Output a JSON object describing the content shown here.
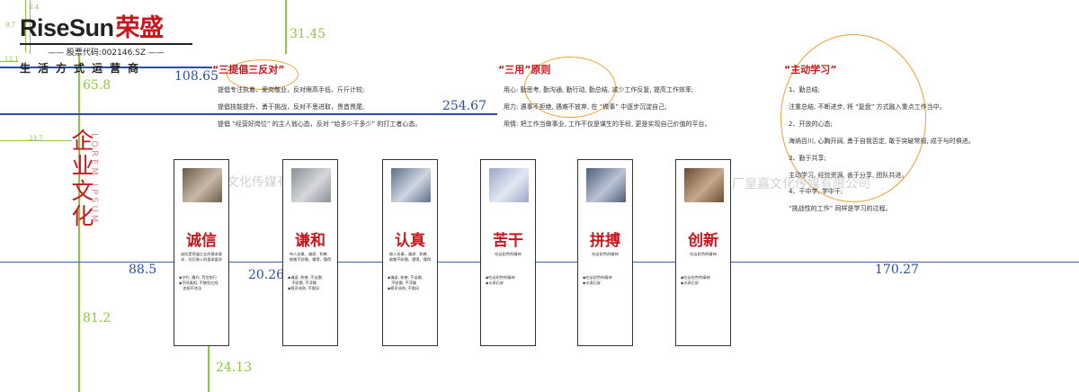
{
  "logo": {
    "brand_latin": "RiseSun",
    "brand_cn": "荣盛",
    "stock": "—— 股票代码:002146.SZ ——",
    "slogan": "生活方式运营商"
  },
  "guides": {
    "green": [
      "8.4",
      "9.7",
      "31.45",
      "12.1",
      "65.8",
      "33.7",
      "81.2",
      "24.13"
    ],
    "blue": [
      "108.65",
      "254.67",
      "88.5",
      "20.26",
      "170.27"
    ]
  },
  "side_title": {
    "cn": "企业文化",
    "latin": "LOREM IPSUM"
  },
  "watermarks": [
    "大厂皇嘉文化传媒有限公司",
    "大厂皇嘉文化传媒有限公司"
  ],
  "sections": [
    {
      "title": "“三提倡三反对”",
      "lines": [
        "提倡专注执着、爱岗敬业，反对眼高手低、斤斤计较;",
        "提倡技能提升、勇于挑战，反对不思进取，畏首畏尾;",
        "提倡 “经营好岗位” 的主人翁心态，反对 “给多少干多少” 的打工者心态。"
      ]
    },
    {
      "title": "“三用”原则",
      "lines": [
        "用心: 勤思考, 勤沟通, 勤行动, 勤总结, 减少工作反复, 提高工作效率;",
        "用力: 遇事不拒绝, 遇难不放弃, 在 “做事” 中逐步沉淀自己;",
        "用情: 把工作当做事业, 工作不仅是谋生的手段, 更是实现自己价值的平台。"
      ]
    },
    {
      "title": "“主动学习”",
      "lines": [
        "1、勤总结;",
        "注重总结, 不断进步, 将 “复盘” 方式融入重点工作当中。",
        "2、开放的心态;",
        "海纳百川, 心胸开阔, 勇于自我否定, 敢于突破常规, 成于与时俱进。",
        "3、勤于共享;",
        "主动学习, 经验资源, 善于分享, 团队共进。",
        "4、干中学, 学中干;",
        "“挑战性的工作” 同样是学习的过程。"
      ]
    }
  ],
  "cards": [
    {
      "title": "诚信",
      "photo_colors": [
        "#6a5a4a",
        "#c9b9a8"
      ],
      "desc": "诚信是荣盛企业的基本要求，往后做人的基本要求",
      "bullets": [
        "◆守约, 履约, 笃信依行",
        "◆不隐真相, 不触犯红线",
        "　违规不违法"
      ]
    },
    {
      "title": "谦和",
      "photo_colors": [
        "#8a8f96",
        "#d6d8dc"
      ],
      "desc": "待人处事，谦逊、和善、能敬不骄傲，懂得，懂得",
      "bullets": [
        "◆谦虚, 和善, 不自傲,",
        "　不骄傲, 不浮躁",
        "◆稳妥成熟, 不跟风"
      ]
    },
    {
      "title": "认真",
      "photo_colors": [
        "#5b6f8a",
        "#cfd6e0"
      ],
      "desc": "做人处事，谦逊、和善、能敬不骄傲，懂得，懂得",
      "bullets": [
        "◆谦虚, 和善, 不自傲,",
        "　不骄傲, 不浮躁",
        "◆稳妥成熟, 不跟风"
      ]
    },
    {
      "title": "苦干",
      "photo_colors": [
        "#9aa6c4",
        "#e3e8f2"
      ],
      "desc": "吃苦耐劳的精神",
      "bullets": [
        "◆吃苦耐劳的精神",
        "◆水滴石穿"
      ]
    },
    {
      "title": "拼搏",
      "photo_colors": [
        "#4e5f7a",
        "#b9c4d6"
      ],
      "desc": "吃苦耐劳的精神",
      "bullets": [
        "◆吃苦耐劳的精神",
        "◆水滴石穿"
      ]
    },
    {
      "title": "创新",
      "photo_colors": [
        "#6b4a34",
        "#c8a98c"
      ],
      "desc": "吃苦耐劳的精神",
      "bullets": [
        "◆吃苦耐劳的精神",
        "◆水滴石穿"
      ]
    }
  ]
}
